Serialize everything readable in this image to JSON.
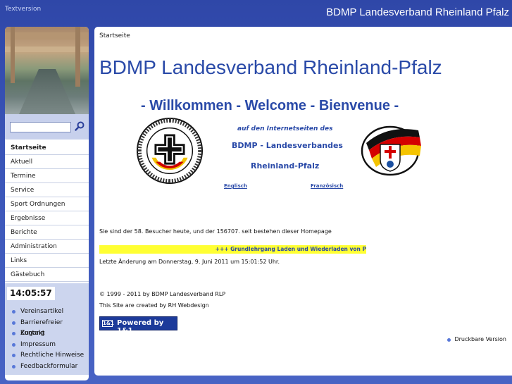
{
  "header": {
    "textversion": "Textversion",
    "site_title": "BDMP Landesverband Rheinland Pfalz"
  },
  "sidebar": {
    "search": {
      "placeholder": "",
      "icon": "search-icon"
    },
    "nav": [
      {
        "label": "Startseite",
        "active": true
      },
      {
        "label": "Aktuell"
      },
      {
        "label": "Termine"
      },
      {
        "label": "Service"
      },
      {
        "label": "Sport Ordnungen"
      },
      {
        "label": "Ergebnisse"
      },
      {
        "label": "Berichte"
      },
      {
        "label": "Administration"
      },
      {
        "label": "Links"
      },
      {
        "label": "Gästebuch"
      }
    ],
    "clock": "14:05:57",
    "extras": [
      {
        "label": "Vereinsartikel"
      },
      {
        "label": "Barrierefreier Zugang"
      },
      {
        "label": "Kontakt"
      },
      {
        "label": "Impressum"
      },
      {
        "label": "Rechtliche Hinweise"
      },
      {
        "label": "Feedbackformular"
      }
    ]
  },
  "main": {
    "breadcrumb": "Startseite",
    "title": "BDMP Landesverband Rheinland-Pfalz",
    "welcome": "- Willkommen - Welcome - Bienvenue -",
    "intro_line1": "auf den Internetseiten des",
    "intro_line2": "BDMP - Landesverbandes",
    "intro_line3": "Rheinland-Pfalz",
    "lang_en": "Englisch",
    "lang_fr": "Französisch",
    "visitors": "Sie sind der 58. Besucher heute, und der 156707. seit bestehen dieser Homepage",
    "ticker": "+++ Grundlehrgang Laden und Wiederladen von P",
    "last_changed": "Letzte Änderung am Donnerstag, 9. Juni 2011 um 15:01:52 Uhr.",
    "copyright": "© 1999 - 2011 by BDMP Landesverband RLP",
    "created_by": "This Site are created by RH Webdesign",
    "powered_logo": "1&1",
    "powered_by": "Powered by 1&1",
    "print_version": "Druckbare Version"
  },
  "colors": {
    "background": "#3a55b8",
    "title_blue": "#2a4aa8",
    "ticker_bg": "#ffff33",
    "sidebar_accent": "#c7d0ec"
  }
}
